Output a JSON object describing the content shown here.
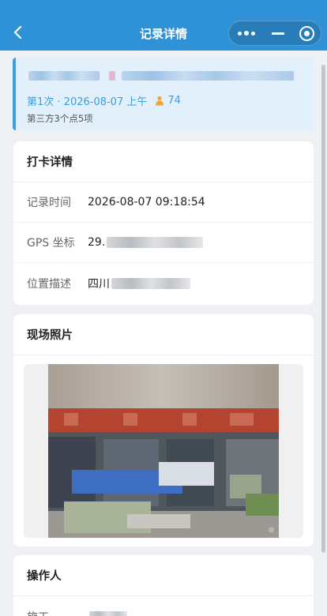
{
  "navbar": {
    "title": "记录详情",
    "back_icon": "chevron-left-icon",
    "bg_color": "#2f91d6"
  },
  "summary": {
    "meta_prefix": "第1次 · 2026-08-07 上午",
    "count": "74",
    "sub": "第三方3个点5项",
    "accent": "#3a9ee0"
  },
  "checkin": {
    "title": "打卡详情",
    "rows": [
      {
        "label": "记录时间",
        "value": "2026-08-07 09:18:54"
      },
      {
        "label": "GPS 坐标",
        "value": "29."
      },
      {
        "label": "位置描述",
        "value": "四川"
      }
    ]
  },
  "photos": {
    "title": "现场照片"
  },
  "operator": {
    "title": "操作人",
    "row_label": "施工"
  }
}
